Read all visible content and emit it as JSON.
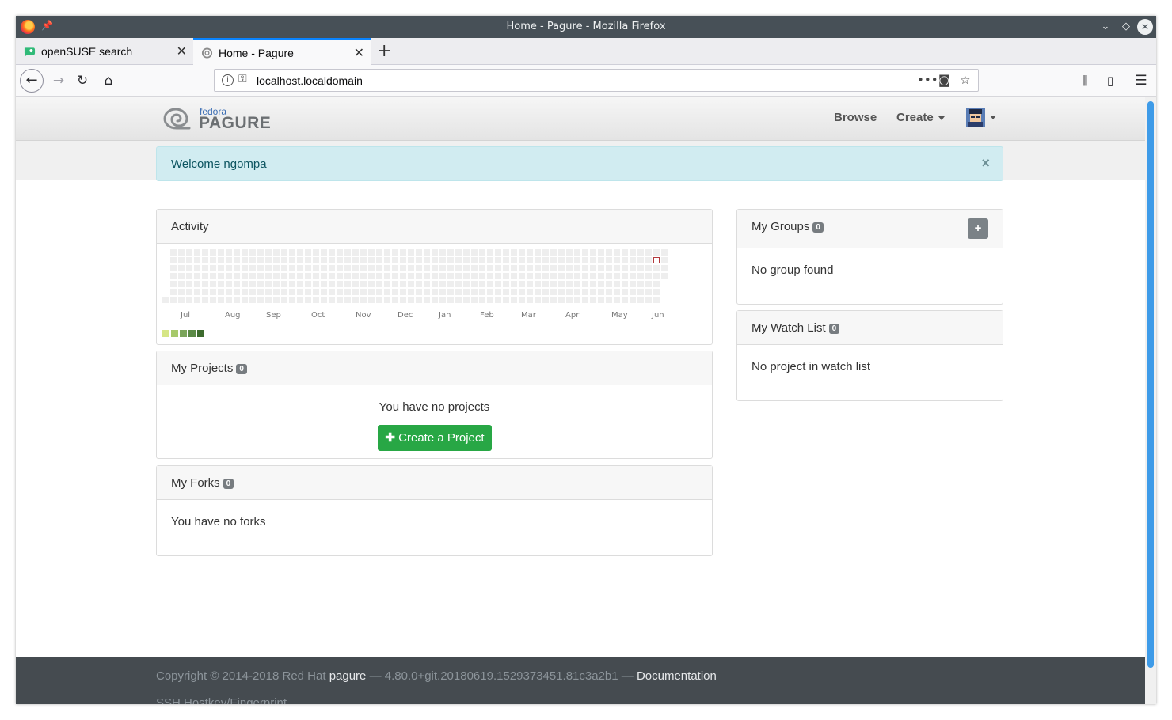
{
  "window": {
    "title": "Home - Pagure - Mozilla Firefox"
  },
  "tabs": [
    {
      "label": "openSUSE search"
    },
    {
      "label": "Home - Pagure"
    }
  ],
  "urlbar": {
    "url": "localhost.localdomain"
  },
  "site": {
    "logo_top": "fedora",
    "logo_main": "PAGURE",
    "nav": {
      "browse": "Browse",
      "create": "Create"
    }
  },
  "alert": {
    "message": "Welcome ngompa",
    "close": "×"
  },
  "activity": {
    "title": "Activity",
    "months": [
      "Jul",
      "Aug",
      "Sep",
      "Oct",
      "Nov",
      "Dec",
      "Jan",
      "Feb",
      "Mar",
      "Apr",
      "May",
      "Jun"
    ],
    "legend_colors": [
      "#d6e685",
      "#a7c96b",
      "#7ba55a",
      "#5b8a46",
      "#3d6b2e"
    ],
    "empty_color": "#eeeeee",
    "today_marker_color": "#b3393d"
  },
  "projects": {
    "title": "My Projects",
    "count": "0",
    "empty_text": "You have no projects",
    "create_button": "Create a Project"
  },
  "forks": {
    "title": "My Forks",
    "count": "0",
    "empty_text": "You have no forks"
  },
  "groups": {
    "title": "My Groups",
    "count": "0",
    "empty_text": "No group found",
    "add_button": "+"
  },
  "watchlist": {
    "title": "My Watch List",
    "count": "0",
    "empty_text": "No project in watch list"
  },
  "footer": {
    "copyright": "Copyright © 2014-2018 Red Hat",
    "pagure_link": "pagure",
    "version": "— 4.80.0+git.20180619.1529373451.81c3a2b1 —",
    "docs_link": "Documentation",
    "ssh": "SSH Hostkey/Fingerprint"
  }
}
